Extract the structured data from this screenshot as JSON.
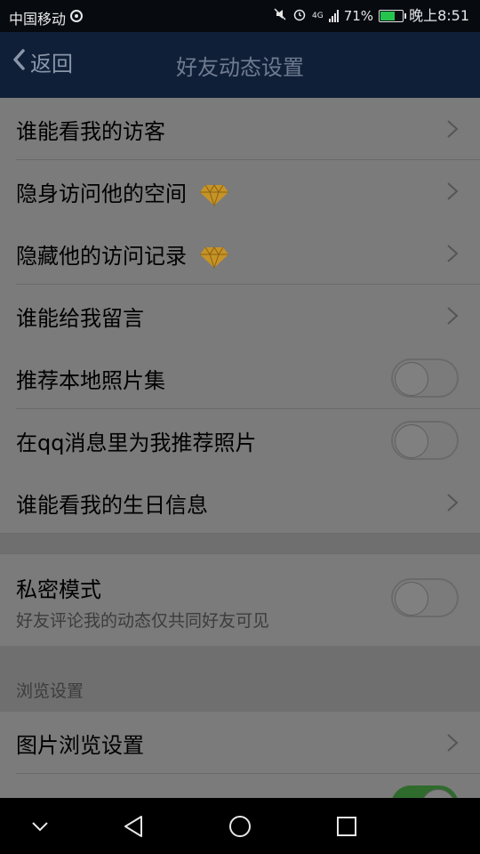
{
  "status_bar": {
    "carrier": "中国移动",
    "network": "4G",
    "battery_percent": "71%",
    "time": "晚上8:51",
    "battery_level": 0.71,
    "battery_color": "#27c34f"
  },
  "nav": {
    "back_label": "返回",
    "title": "好友动态设置"
  },
  "items": {
    "visitors": "谁能看我的访客",
    "hidden_visit": "隐身访问他的空间",
    "hide_records": "隐藏他的访问记录",
    "message": "谁能给我留言",
    "recommend_local": "推荐本地照片集",
    "qq_recommend": "在qq消息里为我推荐照片",
    "birthday": "谁能看我的生日信息",
    "private_mode": "私密模式",
    "private_mode_desc": "好友评论我的动态仅共同好友可见",
    "browse_section": "浏览设置",
    "photo_browse": "图片浏览设置"
  },
  "toggles": {
    "recommend_local": false,
    "qq_recommend": false,
    "private_mode": false,
    "partial_row": true
  },
  "icons": {
    "chevron": "chevron-right-icon",
    "vip": "diamond-icon"
  }
}
